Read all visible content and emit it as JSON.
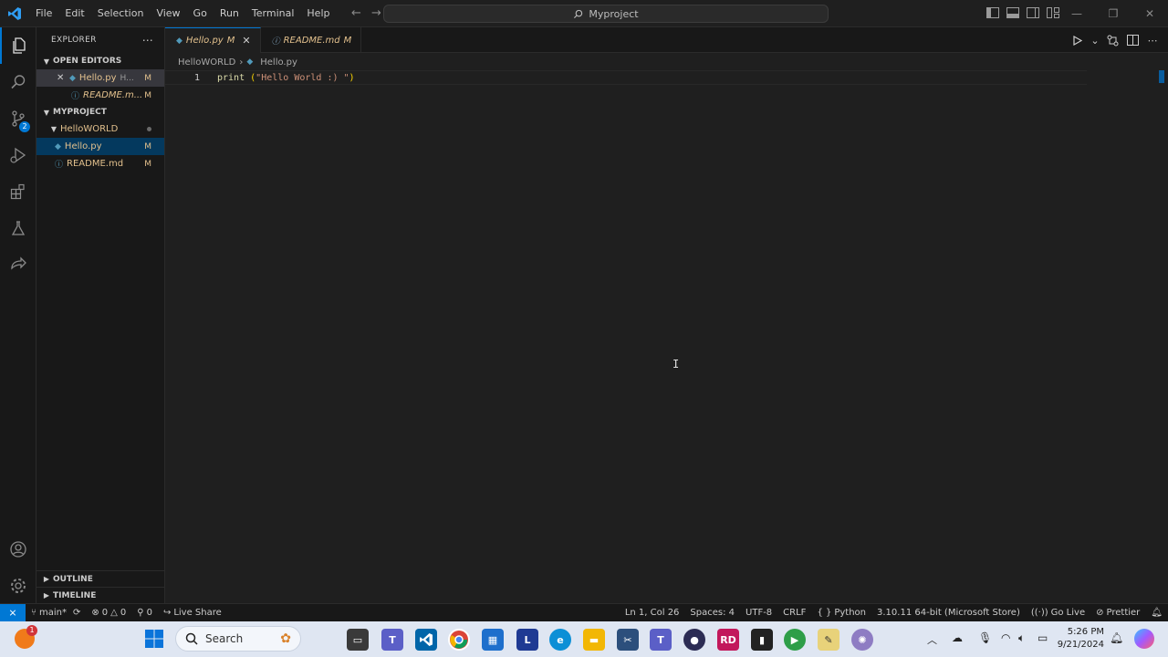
{
  "titlebar": {
    "menu": [
      "File",
      "Edit",
      "Selection",
      "View",
      "Go",
      "Run",
      "Terminal",
      "Help"
    ],
    "search_text": "Myproject"
  },
  "activity_badge": "2",
  "sidebar": {
    "header": "EXPLORER",
    "open_editors_label": "OPEN EDITORS",
    "open_editors": [
      {
        "name": "Hello.py",
        "extra": "H...",
        "status": "M"
      },
      {
        "name": "README.m...",
        "status": "M"
      }
    ],
    "project_label": "MYPROJECT",
    "folder": "HelloWORLD",
    "files": [
      {
        "name": "Hello.py",
        "status": "M"
      },
      {
        "name": "README.md",
        "status": "M"
      }
    ],
    "outline_label": "OUTLINE",
    "timeline_label": "TIMELINE"
  },
  "tabs": [
    {
      "name": "Hello.py",
      "status": "M"
    },
    {
      "name": "README.md",
      "status": "M"
    }
  ],
  "breadcrumb": {
    "folder": "HelloWORLD",
    "file": "Hello.py"
  },
  "editor": {
    "line_number": "1",
    "code_fn": "print",
    "code_open": "(",
    "code_str": "\"Hello World :) \"",
    "code_close": ")"
  },
  "statusbar": {
    "branch": "main*",
    "errors": "0",
    "warnings": "0",
    "ports": "0",
    "live_share": "Live Share",
    "position": "Ln 1, Col 26",
    "spaces": "Spaces: 4",
    "encoding": "UTF-8",
    "eol": "CRLF",
    "language": "Python",
    "interpreter": "3.10.11 64-bit (Microsoft Store)",
    "go_live": "Go Live",
    "prettier": "Prettier"
  },
  "taskbar": {
    "search_label": "Search",
    "notification_badge": "1",
    "time": "5:26 PM",
    "date": "9/21/2024"
  }
}
